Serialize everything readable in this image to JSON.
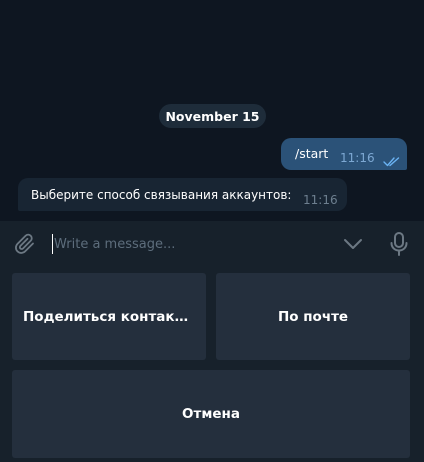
{
  "chat": {
    "date_label": "November 15",
    "messages": [
      {
        "direction": "outgoing",
        "text": "/start",
        "time": "11:16",
        "status": "read"
      },
      {
        "direction": "incoming",
        "text": "Выберите способ связывания аккаунтов:",
        "time": "11:16"
      }
    ]
  },
  "input": {
    "placeholder": "Write a message...",
    "value": "",
    "attach_icon": "paperclip-icon",
    "keyboard_toggle_icon": "chevron-down-icon",
    "mic_icon": "microphone-icon"
  },
  "keyboard": {
    "buttons": [
      {
        "label": "Поделиться контактом"
      },
      {
        "label": "По почте"
      },
      {
        "label": "Отмена"
      }
    ]
  },
  "colors": {
    "background": "#0e1621",
    "panel": "#17212b",
    "outgoing_bubble": "#2b5278",
    "incoming_bubble": "#182533",
    "keyboard_button": "#242f3d",
    "read_check": "#6ab2f2"
  }
}
